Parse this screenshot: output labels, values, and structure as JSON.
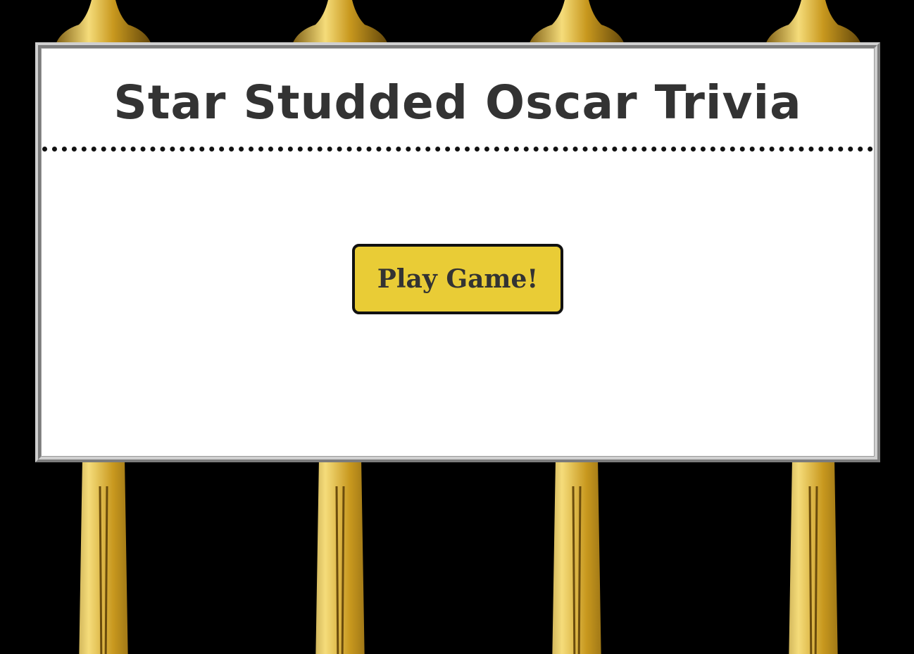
{
  "page": {
    "title": "Star Studded Oscar Trivia",
    "play_button_label": "Play Game!"
  },
  "background": {
    "image": "oscar-statuette-icon",
    "base_color": "#000000",
    "statue_gold": "#d4a62a"
  },
  "colors": {
    "panel": "#ffffff",
    "title_text": "#333333",
    "button_fill": "#e9cc36",
    "button_border": "#111111"
  }
}
